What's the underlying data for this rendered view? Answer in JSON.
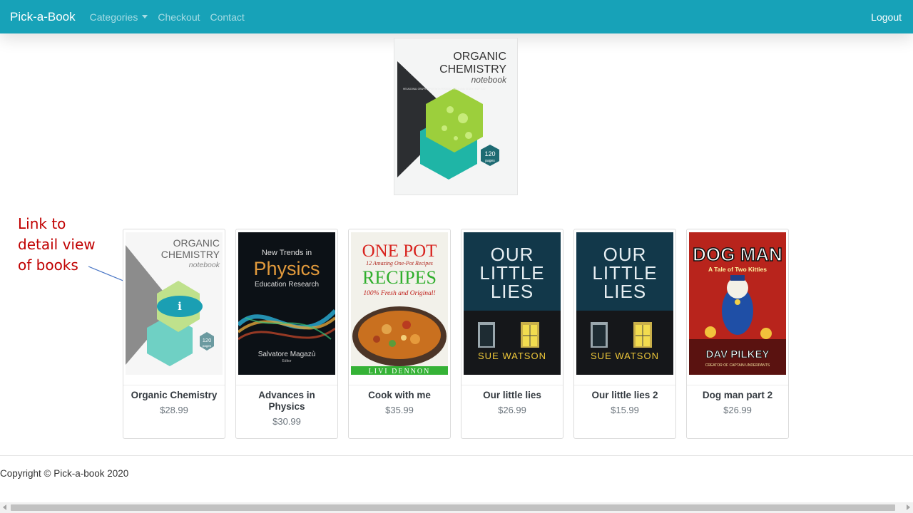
{
  "navbar": {
    "brand": "Pick-a-Book",
    "links": [
      "Categories",
      "Checkout",
      "Contact"
    ],
    "logout": "Logout",
    "color": "#17a2b8"
  },
  "featured": {
    "title_line1": "ORGANIC",
    "title_line2": "CHEMISTRY",
    "subtitle": "notebook",
    "blurb": "HEXAGONAL GRAPH PAPER WITH PERIODIC TABLE AND STUDY HELP TOO",
    "badge_number": "120",
    "badge_unit": "pages"
  },
  "annotation": {
    "line1": "Link to",
    "line2": "detail view",
    "line3": "of books",
    "color": "#c00000"
  },
  "books": [
    {
      "title": "Organic Chemistry",
      "price": "$28.99",
      "cover": "chemistry"
    },
    {
      "title": "Advances in Physics",
      "price": "$30.99",
      "cover": "physics",
      "cover_text": {
        "top": "New Trends in",
        "main": "Physics",
        "sub": "Education Research",
        "author": "Salvatore Magazù",
        "role": "Editor"
      }
    },
    {
      "title": "Cook with me",
      "price": "$35.99",
      "cover": "one-pot",
      "cover_text": {
        "main": "ONE POT",
        "tag": "12 Amazing One-Pot Recipes",
        "main2": "RECIPES",
        "sub": "100% Fresh and Original!",
        "author": "LIVI DENNON"
      }
    },
    {
      "title": "Our little lies",
      "price": "$26.99",
      "cover": "lies",
      "cover_text": {
        "l1": "OUR",
        "l2": "LITTLE",
        "l3": "LIES",
        "author": "SUE WATSON"
      }
    },
    {
      "title": "Our little lies 2",
      "price": "$15.99",
      "cover": "lies",
      "cover_text": {
        "l1": "OUR",
        "l2": "LITTLE",
        "l3": "LIES",
        "author": "SUE WATSON"
      }
    },
    {
      "title": "Dog man part 2",
      "price": "$26.99",
      "cover": "dogman",
      "cover_text": {
        "l1": "DOG MAN",
        "l2": "A Tale of Two Kitties",
        "author": "DAV PILKEY",
        "footer": "CREATOR OF CAPTAIN UNDERPANTS"
      }
    }
  ],
  "footer": {
    "copyright": "Copyright © Pick-a-book 2020"
  }
}
